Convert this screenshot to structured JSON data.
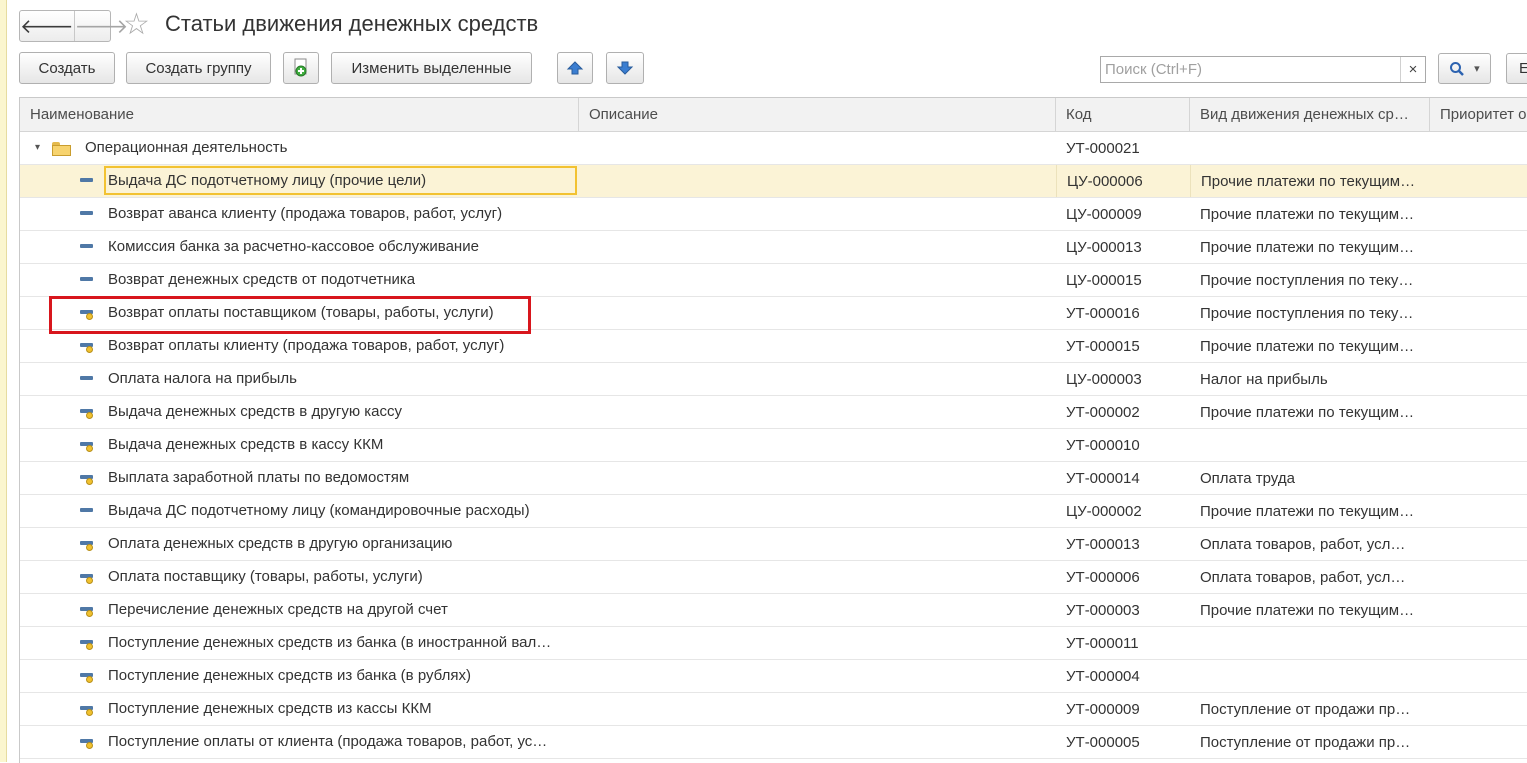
{
  "window": {
    "title": "Статьи движения денежных средств"
  },
  "nav": {
    "back_glyph": "🡐",
    "forward_glyph": "🡒",
    "favorite_glyph": "☆"
  },
  "toolbar": {
    "create": "Создать",
    "create_group": "Создать группу",
    "edit_selected": "Изменить выделенные",
    "search_placeholder": "Поиск (Ctrl+F)",
    "search_clear": "×",
    "more_label": "Е",
    "dropdown_glyph": "▾"
  },
  "table": {
    "columns": [
      "Наименование",
      "Описание",
      "Код",
      "Вид движения денежных ср…",
      "Приоритет о"
    ],
    "group": {
      "name": "Операционная деятельность",
      "code": "УТ-000021",
      "expander": "▾"
    },
    "rows": [
      {
        "name": "Выдача ДС подотчетному лицу (прочие цели)",
        "code": "ЦУ-000006",
        "kind": "Прочие платежи по текущим…",
        "predefined": false
      },
      {
        "name": "Возврат аванса клиенту (продажа товаров, работ, услуг)",
        "code": "ЦУ-000009",
        "kind": "Прочие платежи по текущим…",
        "predefined": false
      },
      {
        "name": "Комиссия банка за расчетно-кассовое обслуживание",
        "code": "ЦУ-000013",
        "kind": "Прочие платежи по текущим…",
        "predefined": false
      },
      {
        "name": "Возврат денежных средств от подотчетника",
        "code": "ЦУ-000015",
        "kind": "Прочие поступления по теку…",
        "predefined": false
      },
      {
        "name": "Возврат оплаты поставщиком (товары, работы, услуги)",
        "code": "УТ-000016",
        "kind": "Прочие поступления по теку…",
        "predefined": true
      },
      {
        "name": "Возврат оплаты клиенту (продажа товаров, работ, услуг)",
        "code": "УТ-000015",
        "kind": "Прочие платежи по текущим…",
        "predefined": true
      },
      {
        "name": "Оплата налога на прибыль",
        "code": "ЦУ-000003",
        "kind": "Налог на прибыль",
        "predefined": false
      },
      {
        "name": "Выдача денежных средств в другую кассу",
        "code": "УТ-000002",
        "kind": "Прочие платежи по текущим…",
        "predefined": true
      },
      {
        "name": "Выдача денежных средств в кассу ККМ",
        "code": "УТ-000010",
        "kind": "",
        "predefined": true
      },
      {
        "name": "Выплата заработной платы по ведомостям",
        "code": "УТ-000014",
        "kind": "Оплата труда",
        "predefined": true
      },
      {
        "name": "Выдача ДС подотчетному лицу (командировочные расходы)",
        "code": "ЦУ-000002",
        "kind": "Прочие платежи по текущим…",
        "predefined": false
      },
      {
        "name": "Оплата денежных средств в другую организацию",
        "code": "УТ-000013",
        "kind": "Оплата товаров, работ, усл…",
        "predefined": true
      },
      {
        "name": "Оплата поставщику (товары, работы, услуги)",
        "code": "УТ-000006",
        "kind": "Оплата товаров, работ, усл…",
        "predefined": true
      },
      {
        "name": "Перечисление денежных средств на другой счет",
        "code": "УТ-000003",
        "kind": "Прочие платежи по текущим…",
        "predefined": true
      },
      {
        "name": "Поступление денежных средств из банка (в иностранной вал…",
        "code": "УТ-000011",
        "kind": "",
        "predefined": true
      },
      {
        "name": "Поступление денежных средств из банка (в рублях)",
        "code": "УТ-000004",
        "kind": "",
        "predefined": true
      },
      {
        "name": "Поступление денежных средств из кассы ККМ",
        "code": "УТ-000009",
        "kind": "Поступление от продажи пр…",
        "predefined": true
      },
      {
        "name": "Поступление оплаты от клиента (продажа товаров, работ, ус…",
        "code": "УТ-000005",
        "kind": "Поступление от продажи пр…",
        "predefined": true
      }
    ],
    "selected_index": 0,
    "highlighted_index": 4
  },
  "colors": {
    "selection": "#fbf3d6",
    "focus_border": "#f2c232",
    "annotation": "#d8161d",
    "icon_blue": "#4f78a6",
    "icon_yellow": "#f1c12e"
  }
}
